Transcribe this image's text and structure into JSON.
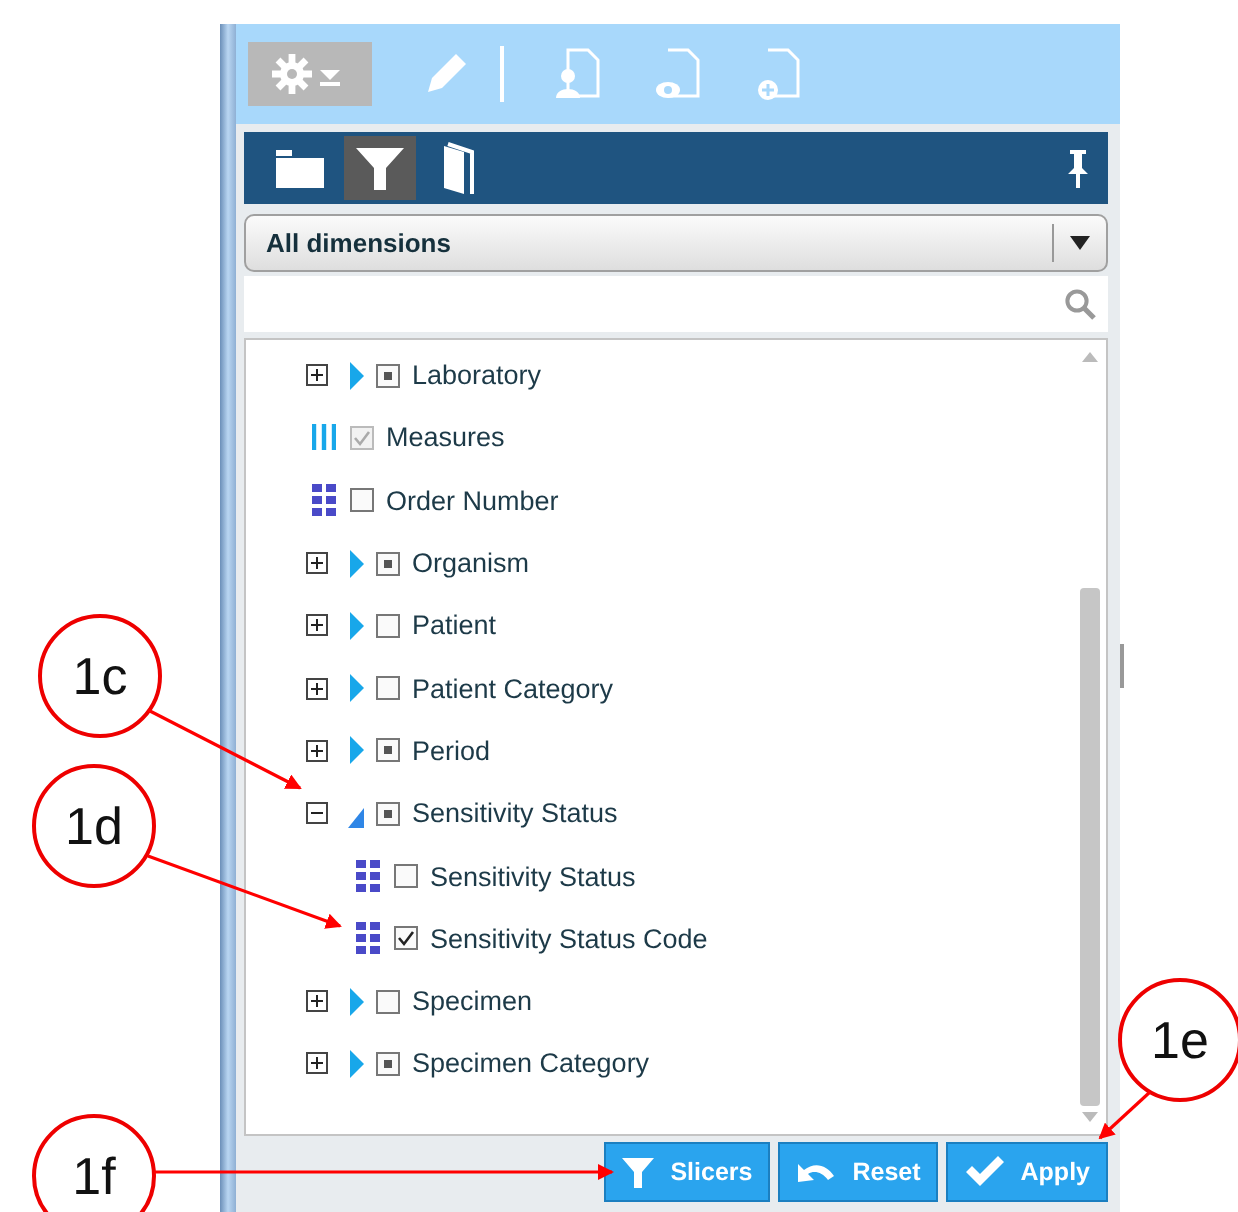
{
  "view_tabs": [
    {
      "kind": "folder",
      "selected": false
    },
    {
      "kind": "filter",
      "selected": true
    },
    {
      "kind": "book",
      "selected": false
    }
  ],
  "dimension_select": {
    "value": "All dimensions"
  },
  "tree": {
    "items": [
      {
        "label": "Laboratory",
        "kind": "dimension",
        "expanded": false,
        "checked": false,
        "partial": true
      },
      {
        "label": "Measures",
        "kind": "measures",
        "checked": true,
        "partial": false,
        "disabled": true
      },
      {
        "label": "Order Number",
        "kind": "attribute",
        "checked": false,
        "partial": false
      },
      {
        "label": "Organism",
        "kind": "dimension",
        "expanded": false,
        "checked": false,
        "partial": true
      },
      {
        "label": "Patient",
        "kind": "dimension",
        "expanded": false,
        "checked": false,
        "partial": false
      },
      {
        "label": "Patient Category",
        "kind": "dimension",
        "expanded": false,
        "checked": false,
        "partial": false
      },
      {
        "label": "Period",
        "kind": "dimension",
        "expanded": false,
        "checked": false,
        "partial": true
      },
      {
        "label": "Sensitivity Status",
        "kind": "dimension",
        "expanded": true,
        "checked": false,
        "partial": true,
        "children": [
          {
            "label": "Sensitivity Status",
            "kind": "attribute",
            "checked": false,
            "partial": false
          },
          {
            "label": "Sensitivity Status Code",
            "kind": "attribute",
            "checked": true,
            "partial": false
          }
        ]
      },
      {
        "label": "Specimen",
        "kind": "dimension",
        "expanded": false,
        "checked": false,
        "partial": false
      },
      {
        "label": "Specimen Category",
        "kind": "dimension",
        "expanded": false,
        "checked": false,
        "partial": true
      }
    ]
  },
  "buttons": [
    {
      "label": "Slicers",
      "kind": "filter"
    },
    {
      "label": "Reset",
      "kind": "undo"
    },
    {
      "label": "Apply",
      "kind": "check"
    }
  ],
  "callouts": [
    {
      "label": "1c"
    },
    {
      "label": "1d"
    },
    {
      "label": "1e"
    },
    {
      "label": "1f"
    }
  ]
}
